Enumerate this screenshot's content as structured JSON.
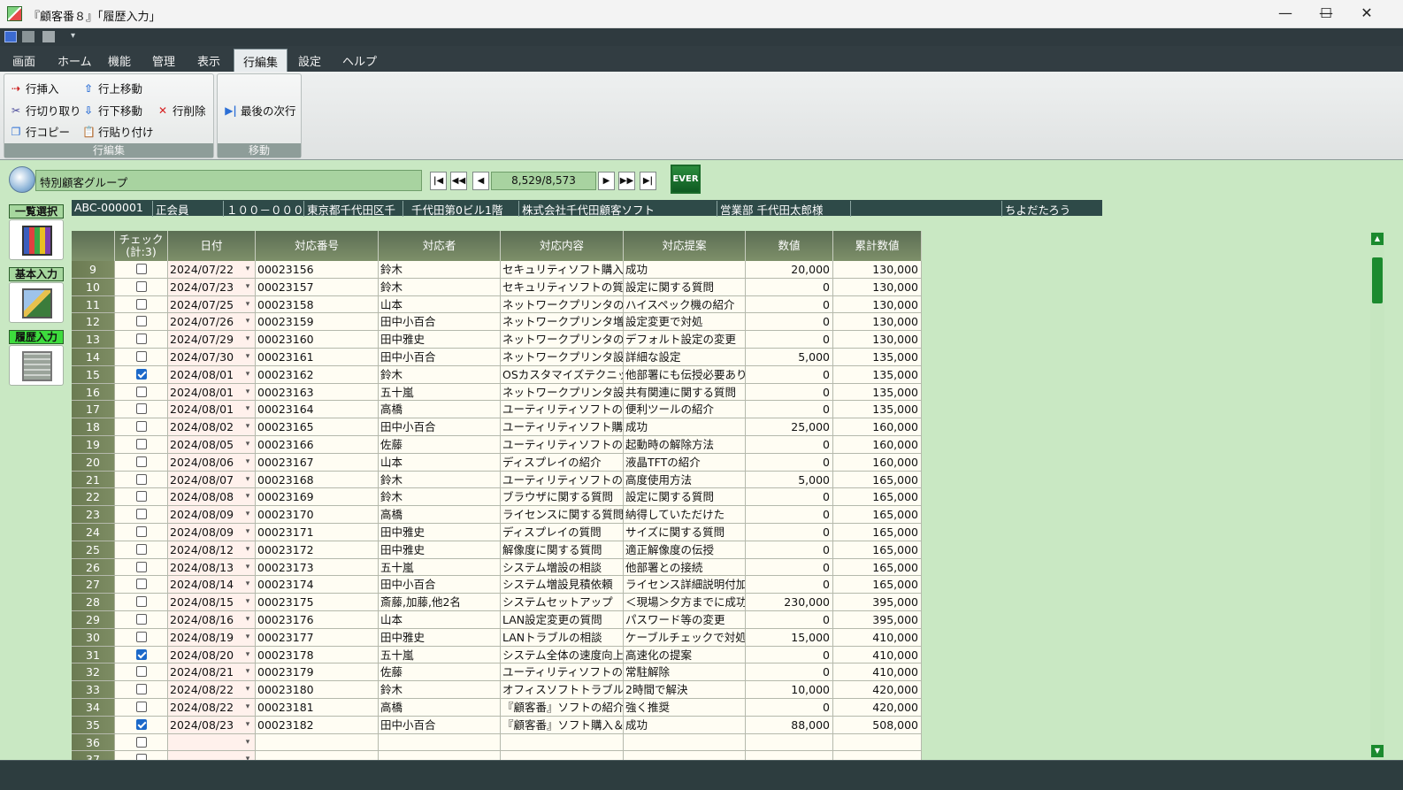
{
  "window": {
    "title": "『顧客番８』「履歴入力」",
    "minimize": "—",
    "maximize": "☐",
    "close": "✕"
  },
  "menu": [
    "画面",
    "ホーム",
    "機能",
    "管理",
    "表示",
    "行編集",
    "設定",
    "ヘルプ"
  ],
  "menu_active": "行編集",
  "ribbon": {
    "edit_group": {
      "label": "行編集",
      "insert_row": "行挿入",
      "move_up": "行上移動",
      "cut_row": "行切り取り",
      "move_down": "行下移動",
      "delete_row": "行削除",
      "copy_row": "行コピー",
      "paste_row": "行貼り付け"
    },
    "move_group": {
      "label": "移動",
      "last_next_row": "最後の次行"
    }
  },
  "record_nav": {
    "group_name": "特別顧客グループ",
    "counter": "8,529/8,573",
    "first": "|◀",
    "prev_page": "◀◀",
    "prev": "◀",
    "next": "▶",
    "next_page": "▶▶",
    "last": "▶|",
    "ever_label": "EVER"
  },
  "side_panel": {
    "list_select": "一覧選択",
    "basic_input": "基本入力",
    "history_input": "履歴入力"
  },
  "customer_info": {
    "code": "ABC-000001",
    "member_type": "正会員",
    "postal": "１００－０００１",
    "address1": "東京都千代田区千",
    "address2": "千代田第0ビル1階",
    "company": "株式会社千代田顧客ソフト",
    "contact": "営業部 千代田太郎様",
    "extra": "",
    "kana": "ちよだたろう"
  },
  "table": {
    "headers": {
      "check": "チェック\n(計:3)",
      "date": "日付",
      "number": "対応番号",
      "person": "対応者",
      "content": "対応内容",
      "proposal": "対応提案",
      "value": "数値",
      "cumulative": "累計数値"
    },
    "rows": [
      {
        "n": "9",
        "checked": false,
        "date": "2024/07/22",
        "no": "00023156",
        "person": "鈴木",
        "content": "セキュリティソフト購入＆セット",
        "proposal": "成功",
        "value": "20,000",
        "cum": "130,000"
      },
      {
        "n": "10",
        "checked": false,
        "date": "2024/07/23",
        "no": "00023157",
        "person": "鈴木",
        "content": "セキュリティソフトの質問",
        "proposal": "設定に関する質問",
        "value": "0",
        "cum": "130,000"
      },
      {
        "n": "11",
        "checked": false,
        "date": "2024/07/25",
        "no": "00023158",
        "person": "山本",
        "content": "ネットワークプリンタの紹介",
        "proposal": "ハイスペック機の紹介",
        "value": "0",
        "cum": "130,000"
      },
      {
        "n": "12",
        "checked": false,
        "date": "2024/07/26",
        "no": "00023159",
        "person": "田中小百合",
        "content": "ネットワークプリンタ増設トラブル",
        "proposal": "設定変更で対処",
        "value": "0",
        "cum": "130,000"
      },
      {
        "n": "13",
        "checked": false,
        "date": "2024/07/29",
        "no": "00023160",
        "person": "田中雅史",
        "content": "ネットワークプリンタの質問",
        "proposal": "デフォルト設定の変更",
        "value": "0",
        "cum": "130,000"
      },
      {
        "n": "14",
        "checked": false,
        "date": "2024/07/30",
        "no": "00023161",
        "person": "田中小百合",
        "content": "ネットワークプリンタ設定の質問",
        "proposal": "詳細な設定",
        "value": "5,000",
        "cum": "135,000"
      },
      {
        "n": "15",
        "checked": true,
        "date": "2024/08/01",
        "no": "00023162",
        "person": "鈴木",
        "content": "OSカスタマイズテクニックの質問",
        "proposal": "他部署にも伝授必要あり",
        "value": "0",
        "cum": "135,000"
      },
      {
        "n": "16",
        "checked": false,
        "date": "2024/08/01",
        "no": "00023163",
        "person": "五十嵐",
        "content": "ネットワークプリンタ設定の質問",
        "proposal": "共有関連に関する質問",
        "value": "0",
        "cum": "135,000"
      },
      {
        "n": "17",
        "checked": false,
        "date": "2024/08/01",
        "no": "00023164",
        "person": "高橋",
        "content": "ユーティリティソフトの紹介",
        "proposal": "便利ツールの紹介",
        "value": "0",
        "cum": "135,000"
      },
      {
        "n": "18",
        "checked": false,
        "date": "2024/08/02",
        "no": "00023165",
        "person": "田中小百合",
        "content": "ユーティリティソフト購入＆セット",
        "proposal": "成功",
        "value": "25,000",
        "cum": "160,000"
      },
      {
        "n": "19",
        "checked": false,
        "date": "2024/08/05",
        "no": "00023166",
        "person": "佐藤",
        "content": "ユーティリティソフトの質問",
        "proposal": "起動時の解除方法",
        "value": "0",
        "cum": "160,000"
      },
      {
        "n": "20",
        "checked": false,
        "date": "2024/08/06",
        "no": "00023167",
        "person": "山本",
        "content": "ディスプレイの紹介",
        "proposal": "液晶TFTの紹介",
        "value": "0",
        "cum": "160,000"
      },
      {
        "n": "21",
        "checked": false,
        "date": "2024/08/07",
        "no": "00023168",
        "person": "鈴木",
        "content": "ユーティリティソフトの質問",
        "proposal": "高度使用方法",
        "value": "5,000",
        "cum": "165,000"
      },
      {
        "n": "22",
        "checked": false,
        "date": "2024/08/08",
        "no": "00023169",
        "person": "鈴木",
        "content": "ブラウザに関する質問",
        "proposal": "設定に関する質問",
        "value": "0",
        "cum": "165,000"
      },
      {
        "n": "23",
        "checked": false,
        "date": "2024/08/09",
        "no": "00023170",
        "person": "高橋",
        "content": "ライセンスに関する質問",
        "proposal": "納得していただけた",
        "value": "0",
        "cum": "165,000"
      },
      {
        "n": "24",
        "checked": false,
        "date": "2024/08/09",
        "no": "00023171",
        "person": "田中雅史",
        "content": "ディスプレイの質問",
        "proposal": "サイズに関する質問",
        "value": "0",
        "cum": "165,000"
      },
      {
        "n": "25",
        "checked": false,
        "date": "2024/08/12",
        "no": "00023172",
        "person": "田中雅史",
        "content": "解像度に関する質問",
        "proposal": "適正解像度の伝授",
        "value": "0",
        "cum": "165,000"
      },
      {
        "n": "26",
        "checked": false,
        "date": "2024/08/13",
        "no": "00023173",
        "person": "五十嵐",
        "content": "システム増設の相談",
        "proposal": "他部署との接続",
        "value": "0",
        "cum": "165,000"
      },
      {
        "n": "27",
        "checked": false,
        "date": "2024/08/14",
        "no": "00023174",
        "person": "田中小百合",
        "content": "システム増設見積依頼",
        "proposal": "ライセンス詳細説明付加",
        "value": "0",
        "cum": "165,000"
      },
      {
        "n": "28",
        "checked": false,
        "date": "2024/08/15",
        "no": "00023175",
        "person": "斎藤,加藤,他2名",
        "content": "システムセットアップ",
        "proposal": "＜現場＞夕方までに成功",
        "value": "230,000",
        "cum": "395,000"
      },
      {
        "n": "29",
        "checked": false,
        "date": "2024/08/16",
        "no": "00023176",
        "person": "山本",
        "content": "LAN設定変更の質問",
        "proposal": "パスワード等の変更",
        "value": "0",
        "cum": "395,000"
      },
      {
        "n": "30",
        "checked": false,
        "date": "2024/08/19",
        "no": "00023177",
        "person": "田中雅史",
        "content": "LANトラブルの相談",
        "proposal": "ケーブルチェックで対処",
        "value": "15,000",
        "cum": "410,000"
      },
      {
        "n": "31",
        "checked": true,
        "date": "2024/08/20",
        "no": "00023178",
        "person": "五十嵐",
        "content": "システム全体の速度向上相談",
        "proposal": "高速化の提案",
        "value": "0",
        "cum": "410,000"
      },
      {
        "n": "32",
        "checked": false,
        "date": "2024/08/21",
        "no": "00023179",
        "person": "佐藤",
        "content": "ユーティリティソフトの質問",
        "proposal": "常駐解除",
        "value": "0",
        "cum": "410,000"
      },
      {
        "n": "33",
        "checked": false,
        "date": "2024/08/22",
        "no": "00023180",
        "person": "鈴木",
        "content": "オフィスソフトトラブルの質問",
        "proposal": "2時間で解決",
        "value": "10,000",
        "cum": "420,000"
      },
      {
        "n": "34",
        "checked": false,
        "date": "2024/08/22",
        "no": "00023181",
        "person": "高橋",
        "content": "『顧客番』ソフトの紹介",
        "proposal": "強く推奨",
        "value": "0",
        "cum": "420,000"
      },
      {
        "n": "35",
        "checked": true,
        "date": "2024/08/23",
        "no": "00023182",
        "person": "田中小百合",
        "content": "『顧客番』ソフト購入＆セット",
        "proposal": "成功",
        "value": "88,000",
        "cum": "508,000"
      },
      {
        "n": "36",
        "checked": false,
        "date": "",
        "no": "",
        "person": "",
        "content": "",
        "proposal": "",
        "value": "",
        "cum": ""
      },
      {
        "n": "37",
        "checked": false,
        "date": "",
        "no": "",
        "person": "",
        "content": "",
        "proposal": "",
        "value": "",
        "cum": ""
      }
    ]
  },
  "colors": {
    "background": "#c9e8c3",
    "header": "#6b7b52",
    "accent": "#1b8a2e",
    "check": "#1c69c9"
  }
}
